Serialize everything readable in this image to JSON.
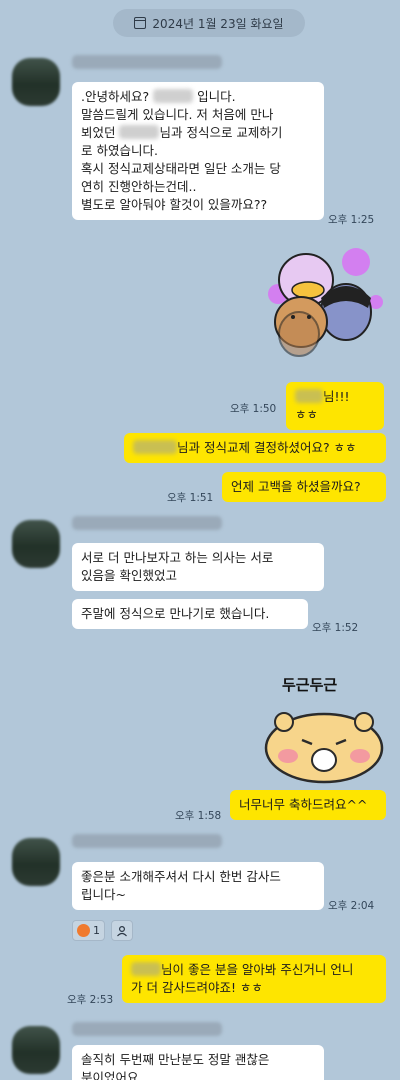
{
  "date_label": "2024년 1월 23일 화요일",
  "messages": [
    {
      "text_a": ".안녕하세요? ",
      "text_b": " 입니다.\n말씀드릴게 있습니다. 저 처음에 만나\n뵈었던 ",
      "text_c": "님과 정식으로 교제하기\n로 하였습니다.\n혹시 정식교제상태라면 일단 소개는 당\n연히 진행안하는건데..\n별도로 알아둬야 할것이 있을까요??",
      "time": "오후 1:25"
    },
    {
      "text_a": "",
      "text_b": "님!!! ㅎㅎ",
      "time": "오후 1:50"
    },
    {
      "text_a": "",
      "text_b": "님과 정식교제 결정하셨어요? ㅎㅎ"
    },
    {
      "text": "언제 고백을 하셨을까요?",
      "time": "오후 1:51"
    },
    {
      "text": "서로 더 만나보자고 하는 의사는 서로\n있음을 확인했었고"
    },
    {
      "text": "주말에 정식으로 만나기로 했습니다.",
      "time": "오후 1:52"
    },
    {
      "text": "너무너무 축하드려요^^",
      "time": "오후 1:58"
    },
    {
      "text": "좋은분 소개해주셔서 다시 한번 감사드\n립니다~",
      "time": "오후 2:04",
      "reaction_count": "1"
    },
    {
      "text_a": "",
      "text_b": "님이 좋은 분을 알아봐 주신거니 언니\n가 더 감사드려야죠! ㅎㅎ",
      "time": "오후 2:53"
    },
    {
      "text": "솔직히 두번째 만난분도 정말 괜찮은\n분이었어요"
    }
  ],
  "stickers": {
    "dugeun_text": "두근두근"
  },
  "colors": {
    "background": "#b2c7d9",
    "my_bubble": "#fee500",
    "their_bubble": "#ffffff"
  }
}
